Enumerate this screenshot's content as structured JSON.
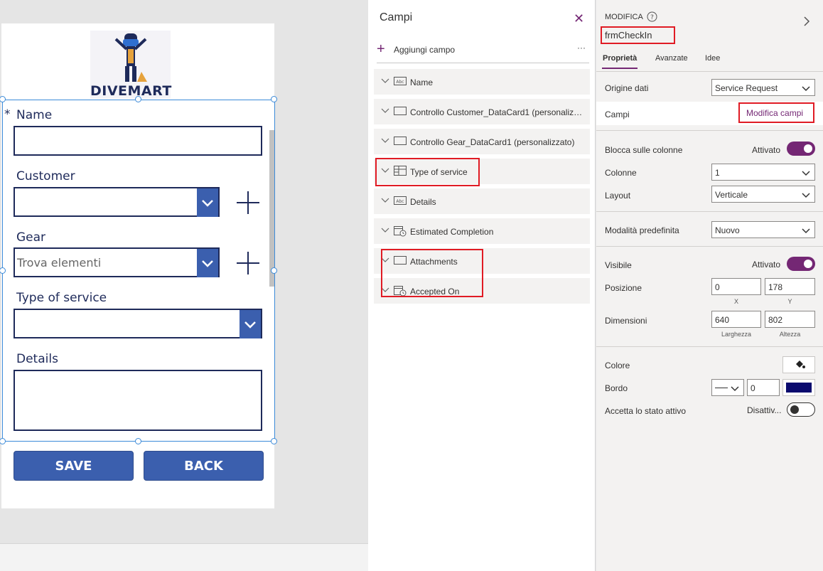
{
  "canvas": {
    "logo_text": "DIVEMART",
    "form": {
      "required_marker": "*",
      "name_label": "Name",
      "customer_label": "Customer",
      "gear_label": "Gear",
      "gear_placeholder": "Trova elementi",
      "type_of_service_label": "Type of service",
      "details_label": "Details"
    },
    "save_label": "SAVE",
    "back_label": "BACK"
  },
  "fields_panel": {
    "title": "Campi",
    "close_icon": "close-icon",
    "add_field_label": "Aggiungi campo",
    "more_label": "···",
    "fields": [
      {
        "label": "Name",
        "icon": "text-field-icon"
      },
      {
        "label": "Controllo Customer_DataCard1 (personalizzato)",
        "icon": "card-icon"
      },
      {
        "label": "Controllo Gear_DataCard1 (personalizzato)",
        "icon": "card-icon"
      },
      {
        "label": "Type of service",
        "icon": "dropdown-grid-icon"
      },
      {
        "label": "Details",
        "icon": "text-field-icon"
      },
      {
        "label": "Estimated Completion",
        "icon": "datetime-icon"
      },
      {
        "label": "Attachments",
        "icon": "card-icon"
      },
      {
        "label": "Accepted On",
        "icon": "datetime-icon"
      }
    ]
  },
  "properties": {
    "header_label": "MODIFICA",
    "control_name": "frmCheckIn",
    "tabs": [
      "Proprietà",
      "Avanzate",
      "Idee"
    ],
    "active_tab": "Proprietà",
    "data_source_label": "Origine dati",
    "data_source_value": "Service Request",
    "fields_label": "Campi",
    "edit_fields_link": "Modifica campi",
    "snap_columns_label": "Blocca sulle colonne",
    "snap_columns_state": "Attivato",
    "columns_label": "Colonne",
    "columns_value": "1",
    "layout_label": "Layout",
    "layout_value": "Verticale",
    "default_mode_label": "Modalità predefinita",
    "default_mode_value": "Nuovo",
    "visible_label": "Visibile",
    "visible_state": "Attivato",
    "position_label": "Posizione",
    "x_value": "0",
    "y_value": "178",
    "x_caption": "X",
    "y_caption": "Y",
    "size_label": "Dimensioni",
    "width_value": "640",
    "height_value": "802",
    "width_caption": "Larghezza",
    "height_caption": "Altezza",
    "color_label": "Colore",
    "border_label": "Bordo",
    "border_width_value": "0",
    "border_color": "#0a0a6e",
    "accept_focus_label": "Accetta lo stato attivo",
    "accept_focus_state": "Disattiv...",
    "accent_color": "#742774",
    "highlight_color": "#e01b24"
  }
}
